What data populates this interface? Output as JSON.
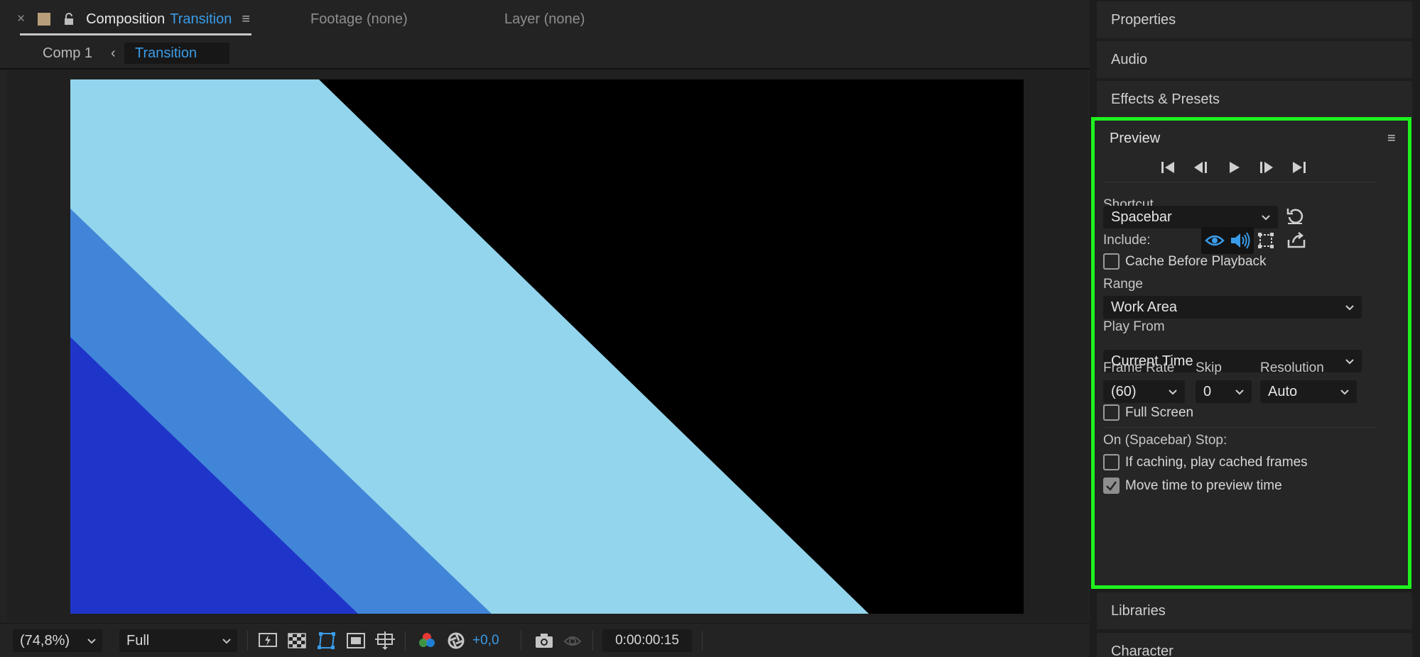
{
  "composition_tab": {
    "close": "×",
    "label": "Composition",
    "name": "Transition",
    "menu": "≡"
  },
  "footage_tab": {
    "label": "Footage (none)"
  },
  "layer_tab": {
    "label": "Layer (none)"
  },
  "breadcrumb": {
    "items": [
      "Comp 1",
      "Transition"
    ],
    "separator": "‹"
  },
  "viewer_toolbar": {
    "zoom": "(74,8%)",
    "resolution": "Full",
    "exposure": "+0,0",
    "timecode": "0:00:00:15",
    "icons": [
      "fast-previews-icon",
      "transparency-grid-icon",
      "mask-path-icon",
      "region-of-interest-icon",
      "guides-icon",
      "color-channels-icon",
      "color-management-icon",
      "snapshot-icon",
      "show-snapshot-icon"
    ]
  },
  "canvas": {
    "colors": {
      "background": "#000000",
      "light_blue": "#93d5ec",
      "mid_blue": "#4185d8",
      "dark_blue": "#1f35c9"
    }
  },
  "right_panels": {
    "properties": "Properties",
    "audio": "Audio",
    "effects": "Effects & Presets",
    "libraries": "Libraries",
    "character": "Character"
  },
  "preview": {
    "title": "Preview",
    "menu": "≡",
    "transport": [
      "first-frame-icon",
      "previous-frame-icon",
      "play-icon",
      "next-frame-icon",
      "last-frame-icon"
    ],
    "shortcut_label": "Shortcut",
    "shortcut_value": "Spacebar",
    "include_label": "Include:",
    "include_toggles": {
      "video": true,
      "audio": true,
      "overlays": false
    },
    "cache_before_playback": {
      "label": "Cache Before Playback",
      "checked": false
    },
    "range_label": "Range",
    "range_value": "Work Area",
    "play_from_label": "Play From",
    "play_from_value": "Current Time",
    "frame_rate_label": "Frame Rate",
    "frame_rate_value": "(60)",
    "skip_label": "Skip",
    "skip_value": "0",
    "resolution_label": "Resolution",
    "resolution_value": "Auto",
    "full_screen": {
      "label": "Full Screen",
      "checked": false
    },
    "stop_label": "On (Spacebar) Stop:",
    "if_caching": {
      "label": "If caching, play cached frames",
      "checked": false
    },
    "move_time": {
      "label": "Move time to preview time",
      "checked": true
    },
    "highlight_color": "#1ef21e"
  }
}
